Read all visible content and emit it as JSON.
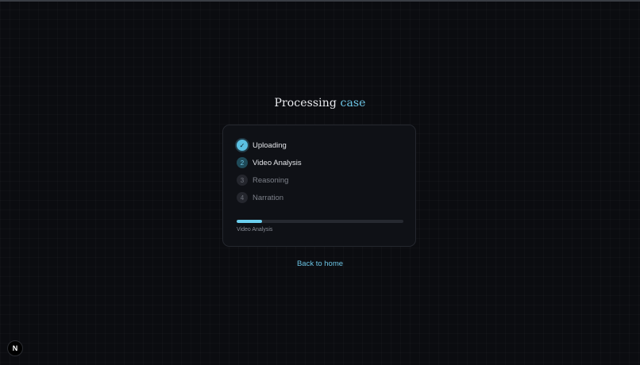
{
  "title": {
    "prefix": "Processing",
    "accent": "case"
  },
  "steps": [
    {
      "indicator": "✓",
      "label": "Uploading",
      "state": "done"
    },
    {
      "indicator": "2",
      "label": "Video Analysis",
      "state": "active"
    },
    {
      "indicator": "3",
      "label": "Reasoning",
      "state": "pending"
    },
    {
      "indicator": "4",
      "label": "Narration",
      "state": "pending"
    }
  ],
  "progress": {
    "fraction": 0.15,
    "caption": "Video Analysis"
  },
  "back_link": "Back to home",
  "badge": {
    "letter": "N",
    "icon": "nextjs-logo-icon"
  },
  "colors": {
    "accent": "#6cc4e4",
    "background": "#0b0c10",
    "card": "#0f1116"
  }
}
